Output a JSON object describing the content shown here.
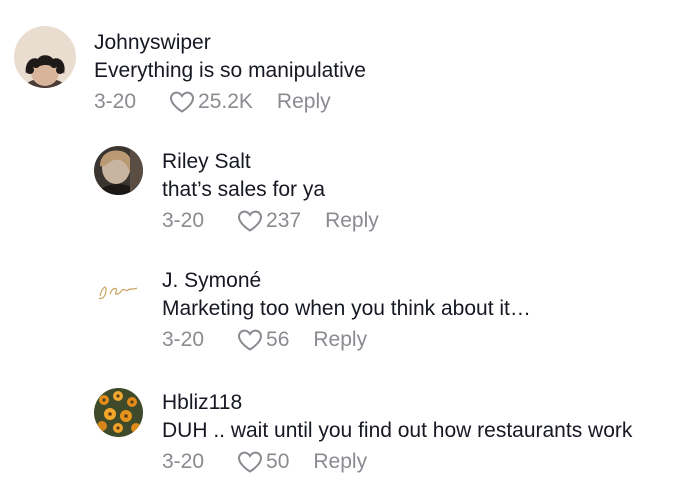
{
  "comments": [
    {
      "username": "Johnyswiper",
      "text": "Everything is so manipulative",
      "date": "3-20",
      "likes": "25.2K",
      "reply_label": "Reply",
      "avatar_icon": "user-avatar-curly-hair"
    },
    {
      "username": "Riley Salt",
      "text": "that’s sales for ya",
      "date": "3-20",
      "likes": "237",
      "reply_label": "Reply",
      "avatar_icon": "user-avatar-photo"
    },
    {
      "username": "J. Symoné",
      "text": "Marketing too when you think about it…",
      "date": "3-20",
      "likes": "56",
      "reply_label": "Reply",
      "avatar_icon": "signature-logo-avatar",
      "avatar_logo_text": "J. Symoné"
    },
    {
      "username": "Hbliz118",
      "text": "DUH .. wait until you find out how restaurants work",
      "date": "3-20",
      "likes": "50",
      "reply_label": "Reply",
      "avatar_icon": "flower-field-avatar"
    }
  ],
  "colors": {
    "text_primary": "#161823",
    "text_secondary": "#8a8b91",
    "background": "#ffffff"
  }
}
